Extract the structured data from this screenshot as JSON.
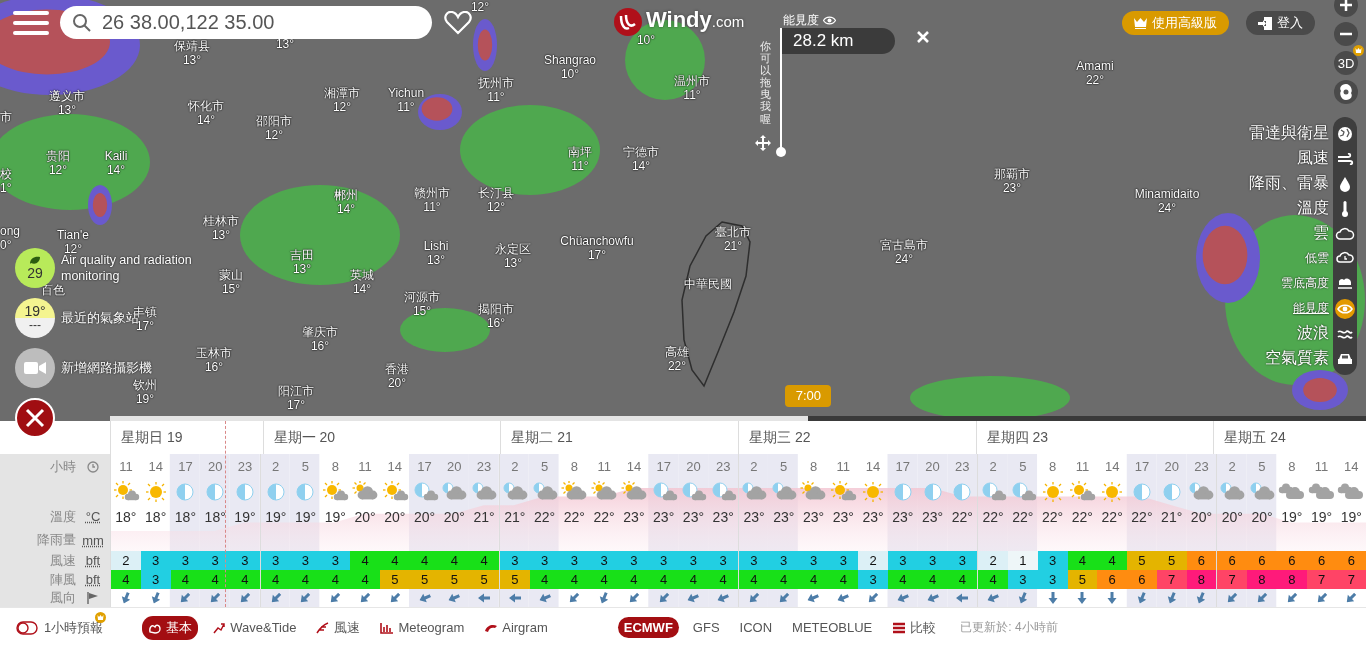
{
  "search": {
    "value": "26 38.00,122 35.00"
  },
  "logo": {
    "name": "Windy",
    "suffix": ".com"
  },
  "visibility_picker": {
    "label": "能見度",
    "value": "28.2 km",
    "drag_hint": "你可以拖曳我喔"
  },
  "header_buttons": [
    {
      "label": "使用高級版",
      "kind": "premium"
    },
    {
      "label": "登入",
      "kind": "login"
    }
  ],
  "view_3d": {
    "label": "3D"
  },
  "layers": [
    {
      "label": "雷達與衛星",
      "kind": "main",
      "selected": false
    },
    {
      "label": "風速",
      "kind": "main",
      "selected": false
    },
    {
      "label": "降雨、雷暴",
      "kind": "main",
      "selected": false
    },
    {
      "label": "溫度",
      "kind": "main",
      "selected": false
    },
    {
      "label": "雲",
      "kind": "main",
      "selected": false
    },
    {
      "label": "低雲",
      "kind": "sub",
      "selected": false
    },
    {
      "label": "雲底高度",
      "kind": "sub",
      "selected": false
    },
    {
      "label": "能見度",
      "kind": "sub",
      "selected": true
    },
    {
      "label": "波浪",
      "kind": "main",
      "selected": false
    },
    {
      "label": "空氣質素",
      "kind": "main",
      "selected": false
    }
  ],
  "map_labels": [
    {
      "temp": "12°"
    },
    {
      "name": "保靖县",
      "temp": "13°"
    },
    {
      "temp": "13°"
    },
    {
      "temp": "10°"
    },
    {
      "name": "Shangrao",
      "temp": "10°"
    },
    {
      "name": "Amami",
      "temp": "22°"
    },
    {
      "name": "抚州市",
      "temp": "11°"
    },
    {
      "name": "温州市",
      "temp": "11°"
    },
    {
      "name": "遵义市",
      "temp": "13°"
    },
    {
      "name": "湘潭市",
      "temp": "12°"
    },
    {
      "name": "Yichun",
      "temp": "11°"
    },
    {
      "name": "怀化市",
      "temp": "14°"
    },
    {
      "name": "市"
    },
    {
      "name": "邵阳市",
      "temp": "12°"
    },
    {
      "name": "贵阳",
      "temp": "12°"
    },
    {
      "name": "Kaili",
      "temp": "14°"
    },
    {
      "name": "南坪",
      "temp": "11°"
    },
    {
      "name": "宁德市",
      "temp": "14°"
    },
    {
      "name": "校",
      "temp": "1°"
    },
    {
      "name": "那覇市",
      "temp": "23°"
    },
    {
      "name": "郴州",
      "temp": "14°"
    },
    {
      "name": "赣州市",
      "temp": "11°"
    },
    {
      "name": "长汀县",
      "temp": "12°"
    },
    {
      "name": "Minamidaito",
      "temp": "24°"
    },
    {
      "name": "桂林市",
      "temp": "13°"
    },
    {
      "name": "ong",
      "temp": "0°"
    },
    {
      "name": "Tian'e",
      "temp": "12°"
    },
    {
      "name": "臺北市",
      "temp": "21°"
    },
    {
      "name": "Lishi",
      "temp": "13°"
    },
    {
      "name": "永定区",
      "temp": "13°"
    },
    {
      "name": "Chüanchowfu",
      "temp": "17°"
    },
    {
      "name": "宮古島市",
      "temp": "24°"
    },
    {
      "name": "吉田",
      "temp": "13°"
    },
    {
      "name": "蒙山",
      "temp": "15°"
    },
    {
      "name": "英城",
      "temp": "14°"
    },
    {
      "name": "中華民國"
    },
    {
      "name": "百色"
    },
    {
      "name": "河源市",
      "temp": "15°"
    },
    {
      "name": "丰镇",
      "temp": "17°"
    },
    {
      "name": "揭阳市",
      "temp": "16°"
    },
    {
      "name": "肇庆市",
      "temp": "16°"
    },
    {
      "name": "玉林市",
      "temp": "16°"
    },
    {
      "name": "高雄",
      "temp": "22°"
    },
    {
      "name": "香港",
      "temp": "20°"
    },
    {
      "name": "钦州",
      "temp": "19°"
    },
    {
      "name": "阳江市",
      "temp": "17°"
    }
  ],
  "widgets": [
    {
      "kind": "air",
      "value": "29",
      "label": "Air quality and radiation monitoring"
    },
    {
      "kind": "station",
      "value": "19°",
      "sub": "---",
      "label": "最近的氣象站"
    },
    {
      "kind": "webcam",
      "label": "新增網路攝影機"
    }
  ],
  "timeline": {
    "time": "7:00",
    "level": 0.556
  },
  "forecast": {
    "row_labels": {
      "hour": {
        "label": "小時"
      },
      "temperature": {
        "label": "溫度",
        "unit": "°C"
      },
      "rain": {
        "label": "降雨量",
        "unit": "mm"
      },
      "wind": {
        "label": "風速",
        "unit": "bft"
      },
      "gust": {
        "label": "陣風",
        "unit": "bft"
      },
      "direction": {
        "label": "風向"
      }
    },
    "days": [
      {
        "label": "星期日 19",
        "hours": [
          {
            "hour": "11",
            "icon": {
              "kind": "sun_small_cloud"
            },
            "temp": "18°",
            "wind": "2",
            "gust": "4",
            "arrow": {
              "kind": "nne"
            },
            "night": false
          },
          {
            "hour": "14",
            "icon": {
              "kind": "sun"
            },
            "temp": "18°",
            "wind": "3",
            "gust": "3",
            "arrow": {
              "kind": "nne"
            },
            "night": false
          },
          {
            "hour": "17",
            "icon": {
              "kind": "moon"
            },
            "temp": "18°",
            "wind": "3",
            "gust": "4",
            "arrow": {
              "kind": "ne"
            },
            "night": true
          },
          {
            "hour": "20",
            "icon": {
              "kind": "moon"
            },
            "temp": "18°",
            "wind": "3",
            "gust": "4",
            "arrow": {
              "kind": "ne"
            },
            "night": true
          },
          {
            "hour": "23",
            "icon": {
              "kind": "moon"
            },
            "temp": "19°",
            "wind": "3",
            "gust": "4",
            "arrow": {
              "kind": "ne"
            },
            "night": true
          }
        ]
      },
      {
        "label": "星期一 20",
        "hours": [
          {
            "hour": "2",
            "icon": {
              "kind": "moon"
            },
            "temp": "19°",
            "wind": "3",
            "gust": "4",
            "arrow": {
              "kind": "ne"
            },
            "night": true
          },
          {
            "hour": "5",
            "icon": {
              "kind": "moon"
            },
            "temp": "19°",
            "wind": "3",
            "gust": "4",
            "arrow": {
              "kind": "ne"
            },
            "night": true
          },
          {
            "hour": "8",
            "icon": {
              "kind": "sun_small_cloud"
            },
            "temp": "19°",
            "wind": "3",
            "gust": "4",
            "arrow": {
              "kind": "ne"
            },
            "night": false
          },
          {
            "hour": "11",
            "icon": {
              "kind": "cloud_sun"
            },
            "temp": "20°",
            "wind": "4",
            "gust": "4",
            "arrow": {
              "kind": "ne"
            },
            "night": false
          },
          {
            "hour": "14",
            "icon": {
              "kind": "sun_small_cloud"
            },
            "temp": "20°",
            "wind": "4",
            "gust": "5",
            "arrow": {
              "kind": "ne"
            },
            "night": false
          },
          {
            "hour": "17",
            "icon": {
              "kind": "moon_small_cloud"
            },
            "temp": "20°",
            "wind": "4",
            "gust": "5",
            "arrow": {
              "kind": "ene"
            },
            "night": true
          },
          {
            "hour": "20",
            "icon": {
              "kind": "moon_cloud"
            },
            "temp": "20°",
            "wind": "4",
            "gust": "5",
            "arrow": {
              "kind": "ene"
            },
            "night": true
          },
          {
            "hour": "23",
            "icon": {
              "kind": "moon_cloud"
            },
            "temp": "21°",
            "wind": "4",
            "gust": "5",
            "arrow": {
              "kind": "e"
            },
            "night": true
          }
        ]
      },
      {
        "label": "星期二 21",
        "hours": [
          {
            "hour": "2",
            "icon": {
              "kind": "moon_cloud"
            },
            "temp": "21°",
            "wind": "3",
            "gust": "5",
            "arrow": {
              "kind": "e"
            },
            "night": true
          },
          {
            "hour": "5",
            "icon": {
              "kind": "moon_cloud"
            },
            "temp": "22°",
            "wind": "3",
            "gust": "4",
            "arrow": {
              "kind": "ene"
            },
            "night": true
          },
          {
            "hour": "8",
            "icon": {
              "kind": "cloud_sun"
            },
            "temp": "22°",
            "wind": "3",
            "gust": "4",
            "arrow": {
              "kind": "ne"
            },
            "night": false
          },
          {
            "hour": "11",
            "icon": {
              "kind": "cloud_sun"
            },
            "temp": "22°",
            "wind": "3",
            "gust": "4",
            "arrow": {
              "kind": "nne"
            },
            "night": false
          },
          {
            "hour": "14",
            "icon": {
              "kind": "cloud_sun"
            },
            "temp": "23°",
            "wind": "3",
            "gust": "4",
            "arrow": {
              "kind": "ne"
            },
            "night": false
          },
          {
            "hour": "17",
            "icon": {
              "kind": "moon_small_cloud"
            },
            "temp": "23°",
            "wind": "3",
            "gust": "4",
            "arrow": {
              "kind": "ne"
            },
            "night": true
          },
          {
            "hour": "20",
            "icon": {
              "kind": "moon_small_cloud"
            },
            "temp": "23°",
            "wind": "3",
            "gust": "4",
            "arrow": {
              "kind": "ene"
            },
            "night": true
          },
          {
            "hour": "23",
            "icon": {
              "kind": "moon_small_cloud"
            },
            "temp": "23°",
            "wind": "3",
            "gust": "4",
            "arrow": {
              "kind": "ene"
            },
            "night": true
          }
        ]
      },
      {
        "label": "星期三 22",
        "hours": [
          {
            "hour": "2",
            "icon": {
              "kind": "moon_cloud"
            },
            "temp": "23°",
            "wind": "3",
            "gust": "4",
            "arrow": {
              "kind": "ne"
            },
            "night": true
          },
          {
            "hour": "5",
            "icon": {
              "kind": "moon_cloud"
            },
            "temp": "23°",
            "wind": "3",
            "gust": "4",
            "arrow": {
              "kind": "ne"
            },
            "night": true
          },
          {
            "hour": "8",
            "icon": {
              "kind": "cloud_sun"
            },
            "temp": "23°",
            "wind": "3",
            "gust": "4",
            "arrow": {
              "kind": "ene"
            },
            "night": false
          },
          {
            "hour": "11",
            "icon": {
              "kind": "sun_small_cloud"
            },
            "temp": "23°",
            "wind": "3",
            "gust": "4",
            "arrow": {
              "kind": "ene"
            },
            "night": false
          },
          {
            "hour": "14",
            "icon": {
              "kind": "sun"
            },
            "temp": "23°",
            "wind": "2",
            "gust": "3",
            "arrow": {
              "kind": "ne"
            },
            "night": false
          },
          {
            "hour": "17",
            "icon": {
              "kind": "moon"
            },
            "temp": "23°",
            "wind": "3",
            "gust": "4",
            "arrow": {
              "kind": "ene"
            },
            "night": true
          },
          {
            "hour": "20",
            "icon": {
              "kind": "moon"
            },
            "temp": "23°",
            "wind": "3",
            "gust": "4",
            "arrow": {
              "kind": "ene"
            },
            "night": true
          },
          {
            "hour": "23",
            "icon": {
              "kind": "moon"
            },
            "temp": "22°",
            "wind": "3",
            "gust": "4",
            "arrow": {
              "kind": "e"
            },
            "night": true
          }
        ]
      },
      {
        "label": "星期四 23",
        "hours": [
          {
            "hour": "2",
            "icon": {
              "kind": "moon_small_cloud"
            },
            "temp": "22°",
            "wind": "2",
            "gust": "4",
            "arrow": {
              "kind": "ene"
            },
            "night": true
          },
          {
            "hour": "5",
            "icon": {
              "kind": "moon_small_cloud"
            },
            "temp": "22°",
            "wind": "1",
            "gust": "3",
            "arrow": {
              "kind": "nne"
            },
            "night": true
          },
          {
            "hour": "8",
            "icon": {
              "kind": "sun"
            },
            "temp": "22°",
            "wind": "3",
            "gust": "3",
            "arrow": {
              "kind": "n"
            },
            "night": false
          },
          {
            "hour": "11",
            "icon": {
              "kind": "sun_small_cloud"
            },
            "temp": "22°",
            "wind": "4",
            "gust": "5",
            "arrow": {
              "kind": "n"
            },
            "night": false
          },
          {
            "hour": "14",
            "icon": {
              "kind": "sun"
            },
            "temp": "22°",
            "wind": "4",
            "gust": "6",
            "arrow": {
              "kind": "n"
            },
            "night": false
          },
          {
            "hour": "17",
            "icon": {
              "kind": "moon"
            },
            "temp": "22°",
            "wind": "5",
            "gust": "6",
            "arrow": {
              "kind": "nne"
            },
            "night": true
          },
          {
            "hour": "20",
            "icon": {
              "kind": "moon"
            },
            "temp": "21°",
            "wind": "5",
            "gust": "7",
            "arrow": {
              "kind": "nne"
            },
            "night": true
          },
          {
            "hour": "23",
            "icon": {
              "kind": "moon_cloud"
            },
            "temp": "20°",
            "wind": "6",
            "gust": "8",
            "arrow": {
              "kind": "nne"
            },
            "night": true
          }
        ]
      },
      {
        "label": "星期五 24",
        "hours": [
          {
            "hour": "2",
            "icon": {
              "kind": "moon_cloud"
            },
            "temp": "20°",
            "wind": "6",
            "gust": "7",
            "arrow": {
              "kind": "ne"
            },
            "night": true
          },
          {
            "hour": "5",
            "icon": {
              "kind": "moon_cloud"
            },
            "temp": "20°",
            "wind": "6",
            "gust": "8",
            "arrow": {
              "kind": "ne"
            },
            "night": true
          },
          {
            "hour": "8",
            "icon": {
              "kind": "clouds"
            },
            "temp": "19°",
            "wind": "6",
            "gust": "8",
            "arrow": {
              "kind": "ne"
            },
            "night": false
          },
          {
            "hour": "11",
            "icon": {
              "kind": "clouds"
            },
            "temp": "19°",
            "wind": "6",
            "gust": "7",
            "arrow": {
              "kind": "ne"
            },
            "night": false
          },
          {
            "hour": "14",
            "icon": {
              "kind": "clouds"
            },
            "temp": "19°",
            "wind": "6",
            "gust": "7",
            "arrow": {
              "kind": "ne"
            },
            "night": false
          }
        ]
      }
    ]
  },
  "bottom_bar": {
    "hourly_toggle": {
      "label": "1小時預報",
      "on": false
    },
    "views": [
      {
        "label": "基本",
        "selected": true
      },
      {
        "label": "Wave&Tide",
        "selected": false
      },
      {
        "label": "風速",
        "selected": false
      },
      {
        "label": "Meteogram",
        "selected": false
      },
      {
        "label": "Airgram",
        "selected": false
      }
    ],
    "models": [
      {
        "label": "ECMWF",
        "selected": true
      },
      {
        "label": "GFS",
        "selected": false
      },
      {
        "label": "ICON",
        "selected": false
      },
      {
        "label": "METEOBLUE",
        "selected": false
      }
    ],
    "compare": "比較",
    "updated": "已更新於: 4小時前"
  }
}
